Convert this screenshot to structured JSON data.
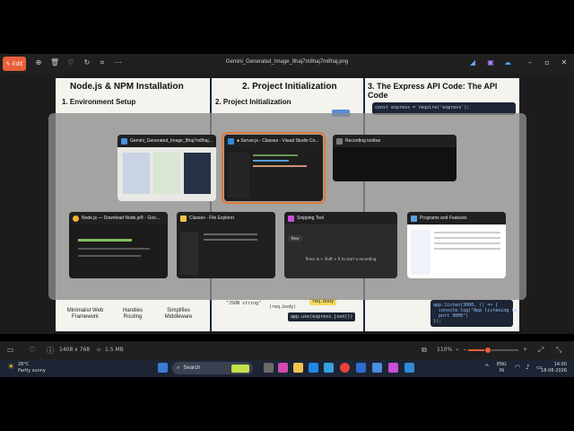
{
  "titlebar": {
    "edit_label": "Edit",
    "title": "Gemini_Generated_Image_8haj7m8haj7m8haj.png"
  },
  "image": {
    "panel1_title": "Node.js & NPM Installation",
    "panel1_sub": "1. Environment Setup",
    "panel2_title": "2. Project Initialization",
    "panel2_sub": "2. Project Initialization",
    "panel3_title": "3. The Express API Code: The API Code",
    "code_top": "const express = require('express');",
    "features": [
      "Minimalist Web Framework",
      "Handles Routing",
      "Simplifies Middleware"
    ],
    "json_string": "\"JSON string\"",
    "req_body": "(req.body)",
    "req_body_tag": "req.body",
    "use_json": "app.use(express.json())",
    "listen_code": "app.listen(3000, () => {\n  console.log(\"App listening to\n  port 3000\")\n});"
  },
  "switcher": {
    "windows": [
      {
        "title": "Gemini_Generated_Image_8haj7m8haj...",
        "icon": "photos-icon",
        "selected": false
      },
      {
        "title": "● Server.js - Classes - Visual Studio Co...",
        "icon": "vscode-icon",
        "selected": true
      },
      {
        "title": "Recording toolbar",
        "icon": "recording-icon",
        "selected": false
      },
      {
        "title": "Node.js — Download Node.js® - Goo...",
        "icon": "chrome-icon",
        "selected": false
      },
      {
        "title": "Classes - File Explorer",
        "icon": "folder-icon",
        "selected": false
      },
      {
        "title": "Snipping Tool",
        "icon": "snip-icon",
        "selected": false
      },
      {
        "title": "Programs and Features",
        "icon": "control-panel-icon",
        "selected": false
      }
    ],
    "snip_new": "New",
    "snip_hint": "Press ⊞ + Shift + R to start a recording"
  },
  "statusbar": {
    "dimensions": "1408 x 768",
    "filesize": "1.5 MB",
    "zoom": "110%",
    "zoom_level": 0.4
  },
  "taskbar": {
    "weather_temp": "28°C",
    "weather_desc": "Partly sunny",
    "search_label": "Search",
    "lang": "ENG",
    "region": "IN",
    "time": "14:00",
    "date": "18-08-2026"
  },
  "colors": {
    "accent": "#e8603a",
    "selected_outline": "#e07a3a",
    "taskbar_bg": "#1d2433"
  }
}
